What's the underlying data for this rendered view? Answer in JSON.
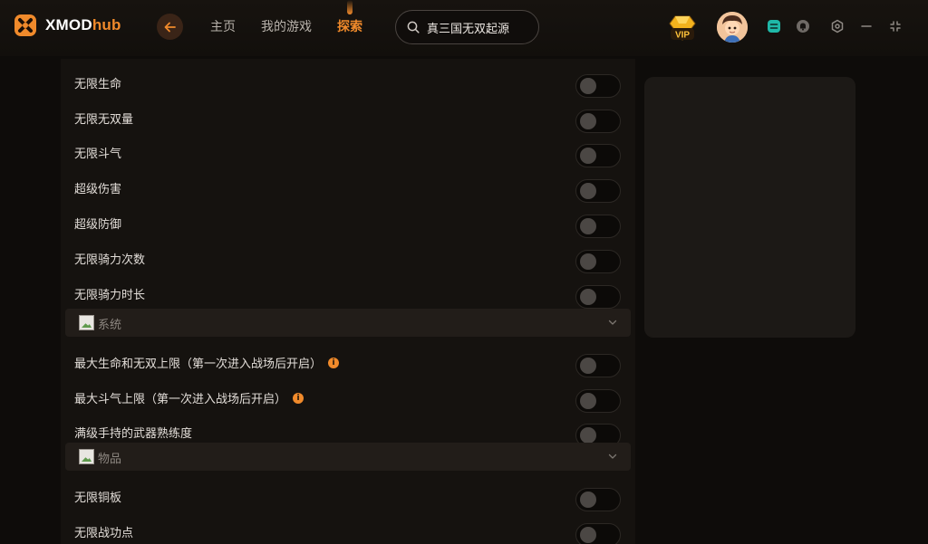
{
  "app": {
    "logo_main": "XMOD",
    "logo_accent": "hub"
  },
  "nav": {
    "items": [
      {
        "label": "主页",
        "active": false
      },
      {
        "label": "我的游戏",
        "active": false
      },
      {
        "label": "探索",
        "active": true
      }
    ]
  },
  "search": {
    "value": "真三国无双起源"
  },
  "badges": {
    "vip_label": "VIP"
  },
  "colors": {
    "accent": "#f08a2b",
    "background": "#0e0c0a",
    "panel": "#15120f",
    "section": "#221d19"
  },
  "rows_top": [
    {
      "label": "无限生命",
      "on": false
    },
    {
      "label": "无限无双量",
      "on": false
    },
    {
      "label": "无限斗气",
      "on": false
    },
    {
      "label": "超级伤害",
      "on": false
    },
    {
      "label": "超级防御",
      "on": false
    },
    {
      "label": "无限骑力次数",
      "on": false
    },
    {
      "label": "无限骑力时长",
      "on": false
    }
  ],
  "section_system": {
    "title": "系统"
  },
  "rows_system": [
    {
      "label": "最大生命和无双上限（第一次进入战场后开启）",
      "info": "i",
      "on": false
    },
    {
      "label": "最大斗气上限（第一次进入战场后开启）",
      "info": "i",
      "on": false
    },
    {
      "label": "满级手持的武器熟练度",
      "on": false
    }
  ],
  "section_items": {
    "title": "物品"
  },
  "rows_items": [
    {
      "label": "无限铜板",
      "on": false
    },
    {
      "label": "无限战功点",
      "on": false
    }
  ]
}
